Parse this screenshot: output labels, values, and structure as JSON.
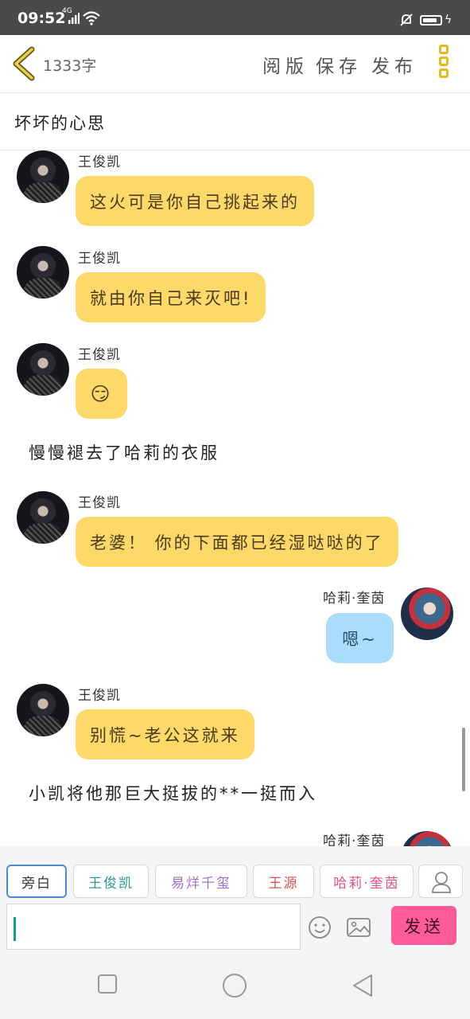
{
  "status": {
    "time": "09:52",
    "network": "4G"
  },
  "header": {
    "char_count": "1333字",
    "menu": [
      "阅版",
      "保存",
      "发布"
    ]
  },
  "story": {
    "title": "坏坏的心思"
  },
  "messages": [
    {
      "kind": "message",
      "sender": "王俊凯",
      "text": "这火可是你自己挑起来的"
    },
    {
      "kind": "message",
      "sender": "王俊凯",
      "text": "就由你自己来灭吧!"
    },
    {
      "kind": "message",
      "sender": "王俊凯",
      "text": "😏"
    },
    {
      "kind": "narration",
      "text": "慢慢褪去了哈莉的衣服"
    },
    {
      "kind": "message",
      "sender": "王俊凯",
      "text": "老婆！ 你的下面都已经湿哒哒的了"
    },
    {
      "kind": "message",
      "sender": "哈莉·奎茵",
      "text": "嗯~"
    },
    {
      "kind": "message",
      "sender": "王俊凯",
      "text": "别慌~老公这就来"
    },
    {
      "kind": "narration",
      "text": "小凯将他那巨大挺拔的**一挺而入"
    },
    {
      "kind": "message",
      "sender": "哈莉·奎茵",
      "text": ""
    }
  ],
  "roles": [
    "旁白",
    "王俊凯",
    "易烊千玺",
    "王源",
    "哈莉·奎茵"
  ],
  "role_colors": [
    "#333333",
    "#2a9d8f",
    "#a070d0",
    "#d9534f",
    "#e0528a"
  ],
  "composer": {
    "send_label": "发送"
  },
  "icons": [
    "back-icon",
    "more-icon",
    "emoji-icon",
    "image-icon",
    "add-role-icon",
    "home-square-icon",
    "home-circle-icon",
    "back-triangle-icon"
  ]
}
